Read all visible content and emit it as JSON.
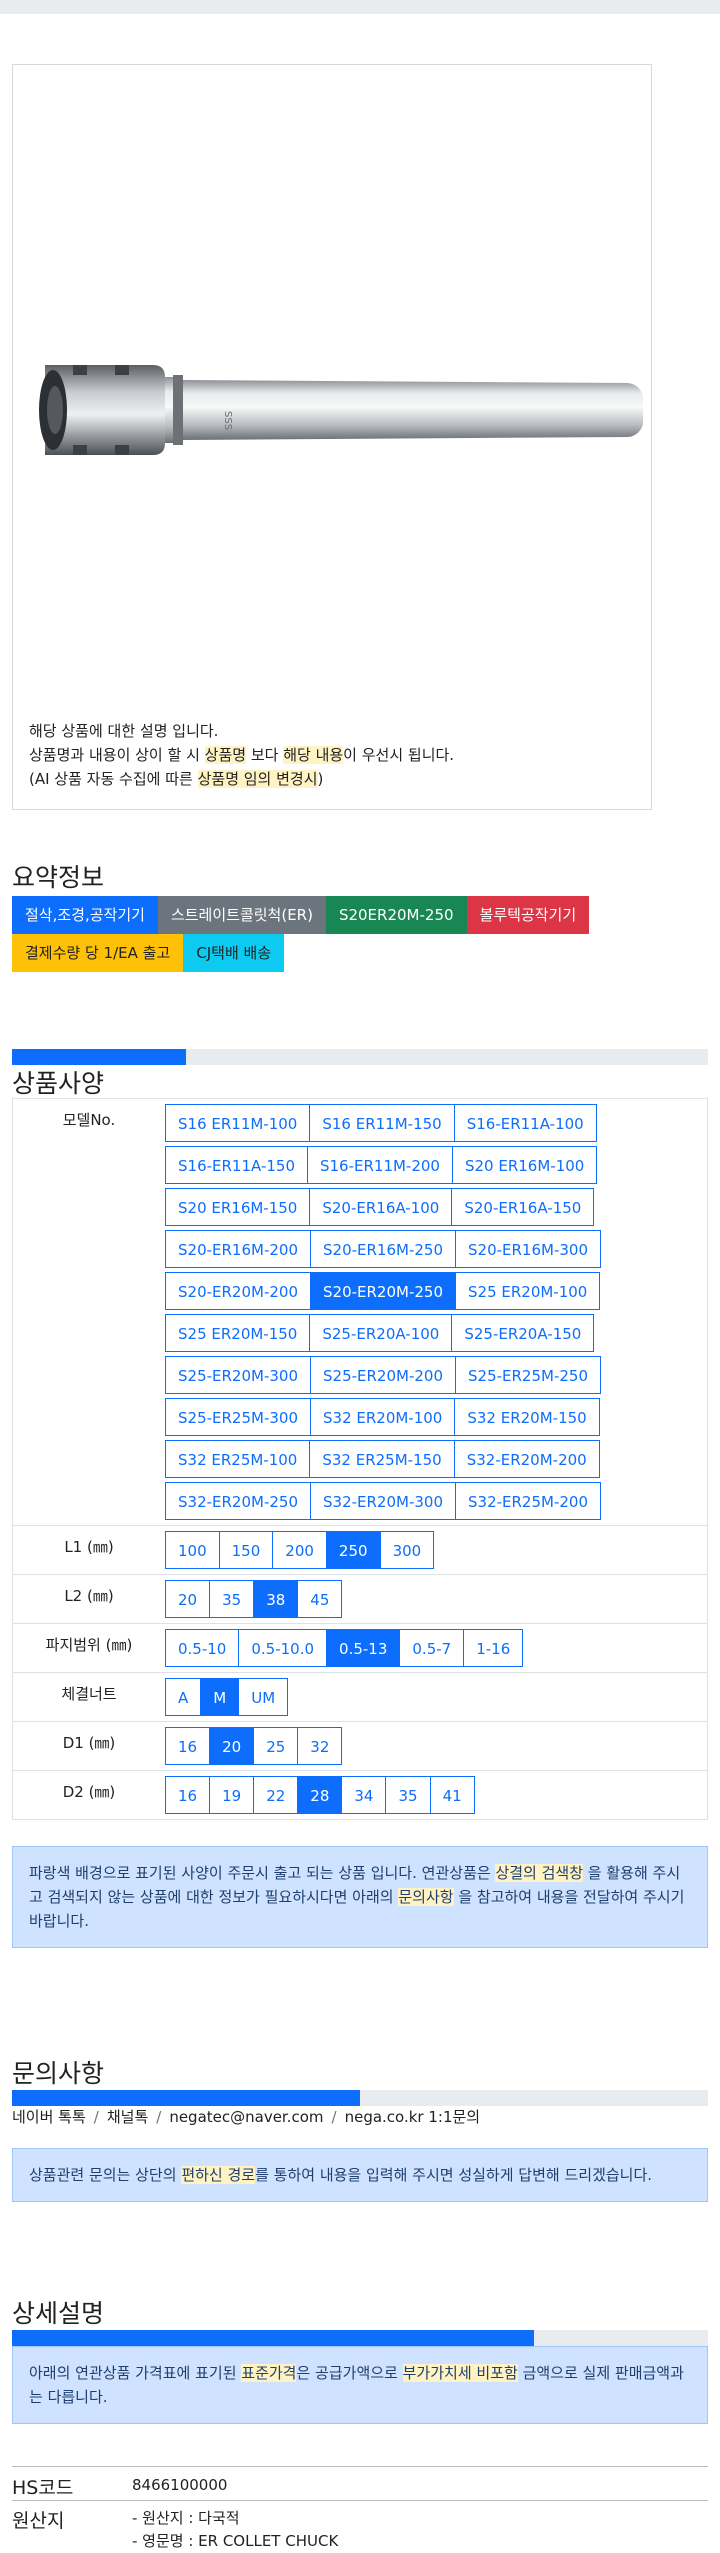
{
  "description": {
    "line1": "해당 상품에 대한 설명 입니다.",
    "line2": [
      {
        "t": "상품명과 내용이 상이 할 시 ",
        "h": false
      },
      {
        "t": "상품명",
        "h": true
      },
      {
        "t": " 보다 ",
        "h": false
      },
      {
        "t": "해당 내용",
        "h": true
      },
      {
        "t": "이 우선시 됩니다.",
        "h": false
      }
    ],
    "line3": [
      {
        "t": "(AI 상품 자동 수집에 따른 ",
        "h": false
      },
      {
        "t": "상품명 임의 변경시",
        "h": true
      },
      {
        "t": ")",
        "h": false
      }
    ],
    "engraving": "SSS"
  },
  "summary": {
    "title": "요약정보",
    "tags_row1": [
      {
        "label": "절삭,조경,공작기기",
        "color": "blue"
      },
      {
        "label": "스트레이트콜릿척(ER)",
        "color": "gray"
      },
      {
        "label": "S20ER20M-250",
        "color": "green"
      },
      {
        "label": "볼루텍공작기기",
        "color": "red"
      }
    ],
    "tags_row2": [
      {
        "label": "결제수량 당 1/EA 출고",
        "color": "yellow"
      },
      {
        "label": "CJ택배 배송",
        "color": "cyan"
      }
    ]
  },
  "spec": {
    "title": "상품사양",
    "progress": 0.25,
    "rows": [
      {
        "label": "모델No.",
        "options": [
          [
            "S16 ER11M-100",
            "S16 ER11M-150",
            "S16-ER11A-100"
          ],
          [
            "S16-ER11A-150",
            "S16-ER11M-200",
            "S20 ER16M-100"
          ],
          [
            "S20 ER16M-150",
            "S20-ER16A-100",
            "S20-ER16A-150"
          ],
          [
            "S20-ER16M-200",
            "S20-ER16M-250",
            "S20-ER16M-300"
          ],
          [
            "S20-ER20M-200",
            "S20-ER20M-250",
            "S25 ER20M-100"
          ],
          [
            "S25 ER20M-150",
            "S25-ER20A-100",
            "S25-ER20A-150"
          ],
          [
            "S25-ER20M-300",
            "S25-ER20M-200",
            "S25-ER25M-250"
          ],
          [
            "S25-ER25M-300",
            "S32 ER20M-100",
            "S32 ER20M-150"
          ],
          [
            "S32 ER25M-100",
            "S32 ER25M-150",
            "S32-ER20M-200"
          ],
          [
            "S32-ER20M-250",
            "S32-ER20M-300",
            "S32-ER25M-200"
          ]
        ],
        "selected": "S20-ER20M-250"
      },
      {
        "label": "L1 (㎜)",
        "options": [
          [
            "100",
            "150",
            "200",
            "250",
            "300"
          ]
        ],
        "selected": "250"
      },
      {
        "label": "L2 (㎜)",
        "options": [
          [
            "20",
            "35",
            "38",
            "45"
          ]
        ],
        "selected": "38"
      },
      {
        "label": "파지범위 (㎜)",
        "options": [
          [
            "0.5-10",
            "0.5-10.0",
            "0.5-13",
            "0.5-7",
            "1-16"
          ]
        ],
        "selected": "0.5-13"
      },
      {
        "label": "체결너트",
        "options": [
          [
            "A",
            "M",
            "UM"
          ]
        ],
        "selected": "M"
      },
      {
        "label": "D1 (㎜)",
        "options": [
          [
            "16",
            "20",
            "25",
            "32"
          ]
        ],
        "selected": "20"
      },
      {
        "label": "D2 (㎜)",
        "options": [
          [
            "16",
            "19",
            "22",
            "28",
            "34",
            "35",
            "41"
          ]
        ],
        "selected": "28"
      }
    ],
    "notice": [
      {
        "t": "파랑색 배경으로 표기된 사양이 주문시 출고 되는 상품 입니다. 연관상품은 ",
        "h": false
      },
      {
        "t": "상결의 검색창",
        "h": true
      },
      {
        "t": " 을 활용해 주시고 검색되지 않는 상품에 대한 정보가 필요하시다면 아래의 ",
        "h": false
      },
      {
        "t": "문의사항",
        "h": true
      },
      {
        "t": " 을 참고하여 내용을 전달하여 주시기 바랍니다.",
        "h": false
      }
    ]
  },
  "inquiry": {
    "title": "문의사항",
    "progress": 0.5,
    "links": [
      "네이버 톡톡",
      "채널톡",
      "negatec@naver.com",
      "nega.co.kr 1:1문의"
    ],
    "notice": [
      {
        "t": "상품관련 문의는 상단의 ",
        "h": false
      },
      {
        "t": "편하신 경로",
        "h": true
      },
      {
        "t": "를 통하여 내용을 입력해 주시면 성실하게 답변해 드리겠습니다.",
        "h": false
      }
    ]
  },
  "detail": {
    "title": "상세설명",
    "progress": 0.75,
    "notice": [
      {
        "t": "아래의 연관상품 가격표에 표기된 ",
        "h": false
      },
      {
        "t": "표준가격",
        "h": true
      },
      {
        "t": "은 공급가액으로 ",
        "h": false
      },
      {
        "t": "부가가치세 비포함",
        "h": true
      },
      {
        "t": " 금액으로 실제 판매금액과는 다릅니다.",
        "h": false
      }
    ]
  },
  "hs": {
    "label": "HS코드",
    "value": "8466100000",
    "origin_label": "원산지",
    "origin_lines": [
      "- 원산지 : 다국적",
      "- 영문명 : ER COLLET CHUCK"
    ]
  }
}
